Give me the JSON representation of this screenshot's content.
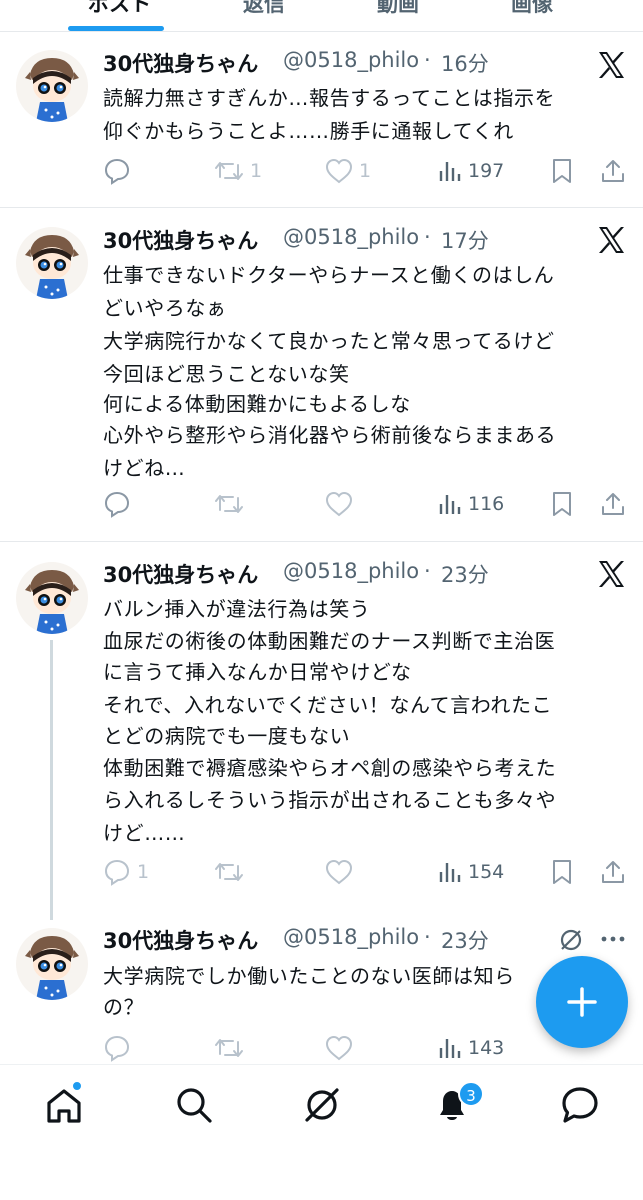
{
  "tabs": [
    {
      "label": "ポスト",
      "active": true
    },
    {
      "label": "返信",
      "active": false
    },
    {
      "label": "動画",
      "active": false
    },
    {
      "label": "画像",
      "active": false
    }
  ],
  "posts": [
    {
      "name": "30代独身ちゃん",
      "handle": "@0518_philo",
      "time": "16分",
      "lines": [
        "読解力無さすぎんか…報告するってことは指示を",
        "仰ぐかもらうことよ……勝手に通報してくれ"
      ],
      "replies": "",
      "reposts": "1",
      "likes": "1",
      "views": "197"
    },
    {
      "name": "30代独身ちゃん",
      "handle": "@0518_philo",
      "time": "17分",
      "lines": [
        "仕事できないドクターやらナースと働くのはしん",
        "どいやろなぁ",
        "大学病院行かなくて良かったと常々思ってるけど",
        "今回ほど思うことないな笑",
        "何による体動困難かにもよるしな",
        "心外やら整形やら消化器やら術前後ならままある",
        "けどね…"
      ],
      "replies": "",
      "reposts": "",
      "likes": "",
      "views": "116"
    },
    {
      "name": "30代独身ちゃん",
      "handle": "@0518_philo",
      "time": "23分",
      "lines": [
        "バルン挿入が違法行為は笑う",
        "血尿だの術後の体動困難だのナース判断で主治医",
        "に言うて挿入なんか日常やけどな",
        "それで、入れないでください！なんて言われたこ",
        "とどの病院でも一度もない",
        "体動困難で褥瘡感染やらオペ創の感染やら考えた",
        "ら入れるしそういう指示が出されることも多々や",
        "けど……"
      ],
      "replies": "1",
      "reposts": "",
      "likes": "",
      "views": "154"
    },
    {
      "name": "30代独身ちゃん",
      "handle": "@0518_philo",
      "time": "23分",
      "lines": [
        "大学病院でしか働いたことのない医師は知ら",
        "の？"
      ],
      "replies": "",
      "reposts": "",
      "likes": "",
      "views": "143"
    }
  ],
  "notifications_badge": "3",
  "icons": {
    "reply": "reply-icon",
    "repost": "repost-icon",
    "like": "like-icon",
    "views": "views-icon",
    "bookmark": "bookmark-icon",
    "share": "share-icon",
    "x_logo": "x-logo-icon",
    "grok": "grok-icon",
    "more": "more-icon",
    "compose": "compose-icon",
    "home": "home-icon",
    "search": "search-icon",
    "notifications": "bell-icon",
    "messages": "messages-icon"
  },
  "colors": {
    "accent": "#1d9bf0",
    "text": "#0f1419",
    "muted": "#536471",
    "divider": "#e6e9ec"
  }
}
